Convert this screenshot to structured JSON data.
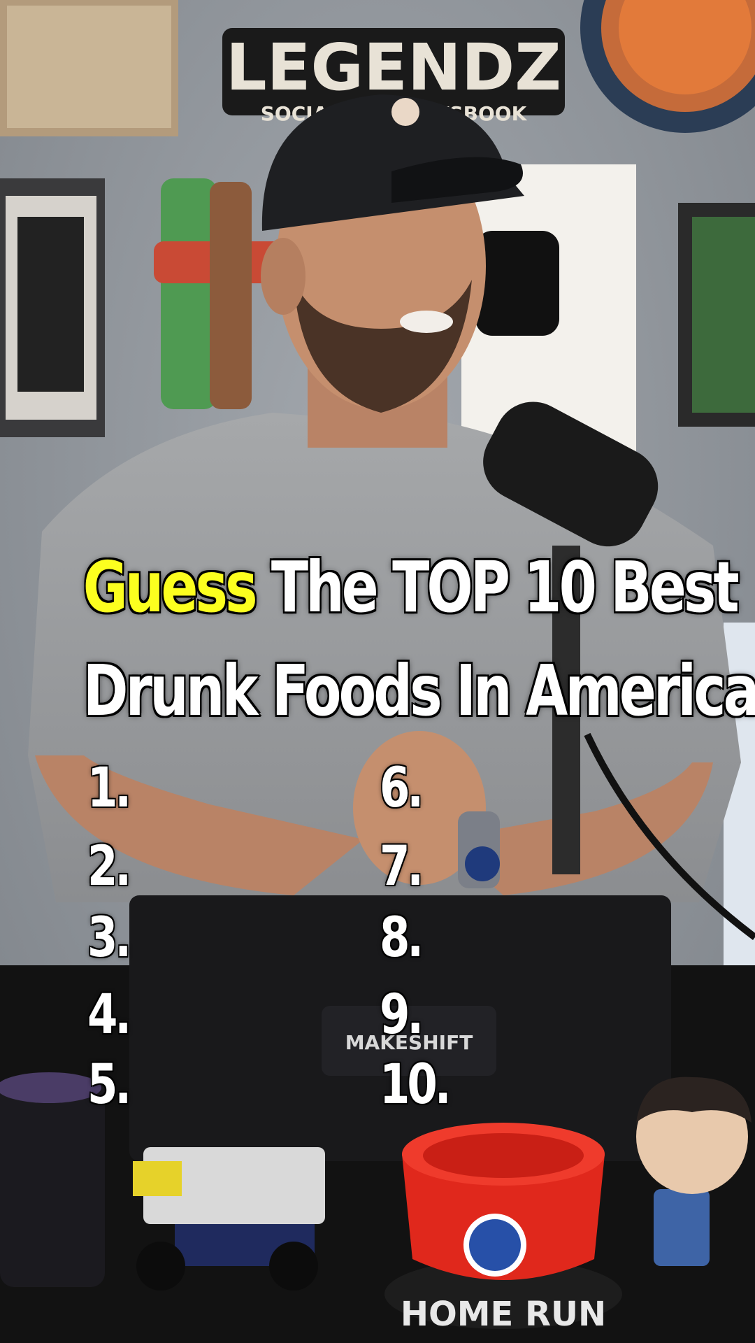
{
  "caption": {
    "highlight": "Guess",
    "line1_rest": "The TOP 10 Best",
    "line2": "Drunk Foods In America",
    "highlight_color": "#fcff1f"
  },
  "list": {
    "left": [
      "1.",
      "2.",
      "3.",
      "4.",
      "5."
    ],
    "right": [
      "6.",
      "7.",
      "8.",
      "9.",
      "10."
    ]
  },
  "scene": {
    "wall_sign": "LEGENDZ",
    "wall_sign_sub": "SOCIAL ... SPORTSBOOK",
    "laptop_logo": "MAKESHIFT",
    "bowl_text": "HOME RUN",
    "colors": {
      "wall": "#8f949a",
      "shirt": "#9a9c9e",
      "skin": "#c58f6e",
      "cap": "#1e1f22",
      "desk": "#121212",
      "laptop": "#19191b",
      "bowl": "#e0281c"
    }
  }
}
